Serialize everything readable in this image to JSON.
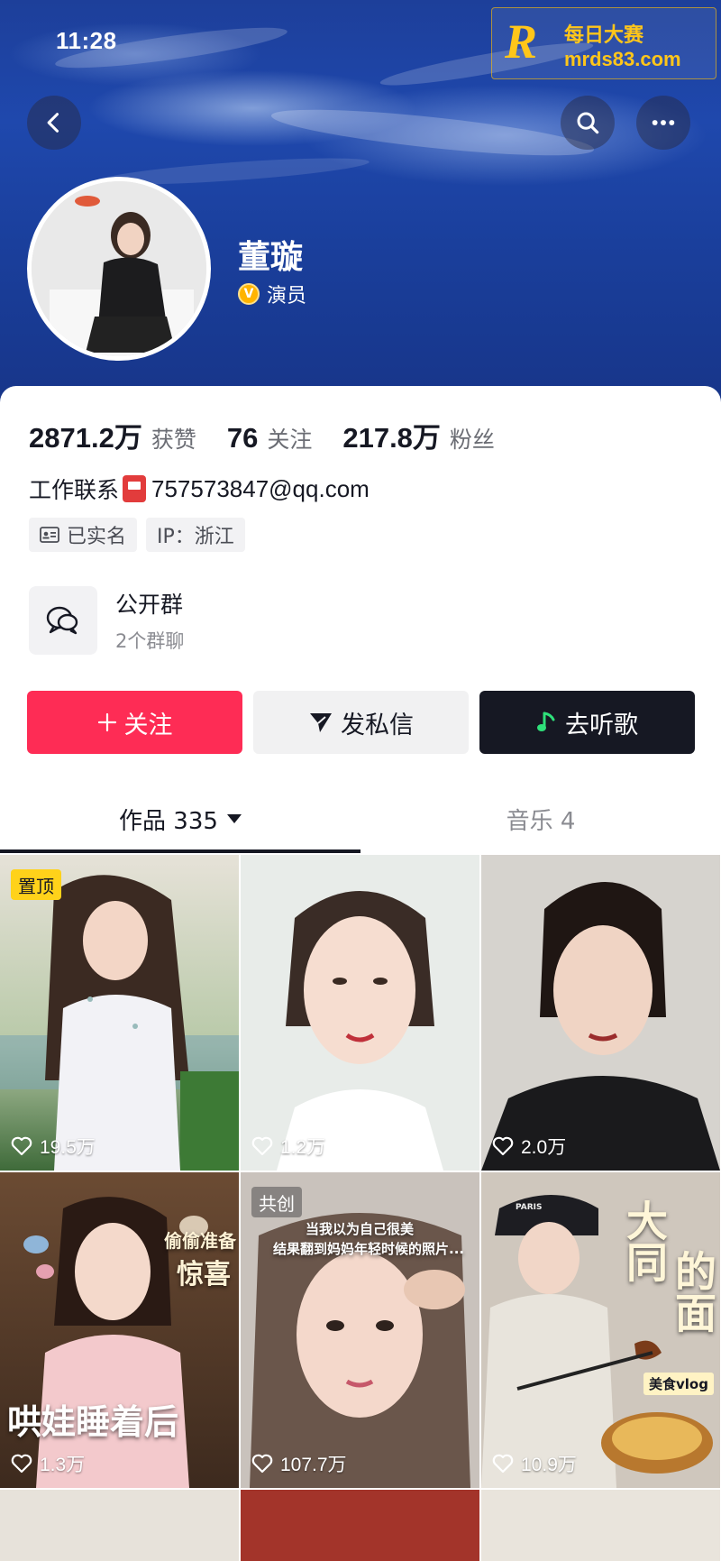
{
  "status_bar": {
    "time": "11:28"
  },
  "watermark": {
    "top_text": "每日大赛",
    "bottom_text": "mrds83.com"
  },
  "header": {
    "back_icon": "chevron-left-icon",
    "search_icon": "search-icon",
    "more_icon": "more-dots-icon"
  },
  "profile": {
    "name": "董璇",
    "verified_title": "演员",
    "verified_badge": "V"
  },
  "stats": [
    {
      "value": "2871.2万",
      "label": "获赞"
    },
    {
      "value": "76",
      "label": "关注"
    },
    {
      "value": "217.8万",
      "label": "粉丝"
    }
  ],
  "contact": {
    "label": "工作联系",
    "email": "757573847@qq.com"
  },
  "tags": [
    {
      "text": "已实名",
      "icon": "id-card-icon"
    },
    {
      "text": "IP：浙江"
    }
  ],
  "group": {
    "title": "公开群",
    "subtitle": "2个群聊"
  },
  "actions": {
    "follow": "关注",
    "message": "发私信",
    "music": "去听歌"
  },
  "tabs": [
    {
      "label": "作品 335",
      "active": true
    },
    {
      "label": "音乐 4",
      "active": false
    }
  ],
  "videos": [
    {
      "likes": "19.5万",
      "badge": "置顶"
    },
    {
      "likes": "1.2万"
    },
    {
      "likes": "2.0万"
    },
    {
      "likes": "1.3万",
      "overlay_small": "偷偷准备",
      "overlay_big": "惊喜",
      "overlay_bottom": "哄娃睡着后"
    },
    {
      "likes": "107.7万",
      "badge": "共创",
      "overlay_caption_1": "当我以为自己很美",
      "overlay_caption_2": "结果翻到妈妈年轻时候的照片..."
    },
    {
      "likes": "10.9万",
      "overlay_title_1": "大同",
      "overlay_title_2": "的面",
      "overlay_tag": "美食vlog",
      "cap_text": "PARIS"
    }
  ],
  "colors": {
    "follow_button": "#fe2c55",
    "music_button": "#161823",
    "pin_badge": "#ffd21a"
  }
}
